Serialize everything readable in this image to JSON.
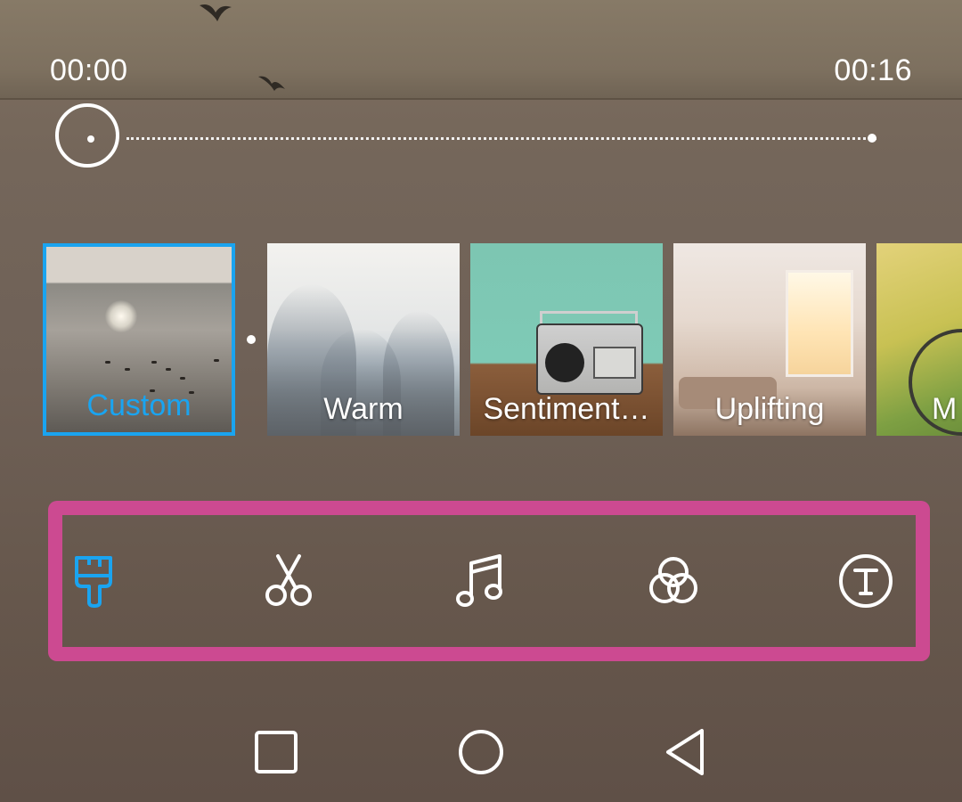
{
  "player": {
    "current_time": "00:00",
    "total_time": "00:16",
    "progress": 0
  },
  "themes": [
    {
      "label": "Custom",
      "selected": true
    },
    {
      "label": "Warm",
      "selected": false
    },
    {
      "label": "Sentiment…",
      "selected": false
    },
    {
      "label": "Uplifting",
      "selected": false
    },
    {
      "label": "M",
      "selected": false
    }
  ],
  "toolbar": {
    "items": [
      {
        "icon": "paintbrush-icon",
        "active": true
      },
      {
        "icon": "scissors-icon",
        "active": false
      },
      {
        "icon": "music-note-icon",
        "active": false
      },
      {
        "icon": "filter-circles-icon",
        "active": false
      },
      {
        "icon": "text-icon",
        "active": false
      }
    ]
  },
  "navigation": {
    "buttons": [
      {
        "icon": "recent-apps-icon"
      },
      {
        "icon": "home-icon"
      },
      {
        "icon": "back-icon"
      }
    ]
  },
  "colors": {
    "accent": "#1aa4f0",
    "highlight_frame": "#cc4a91",
    "icon_default": "#ffffff"
  }
}
